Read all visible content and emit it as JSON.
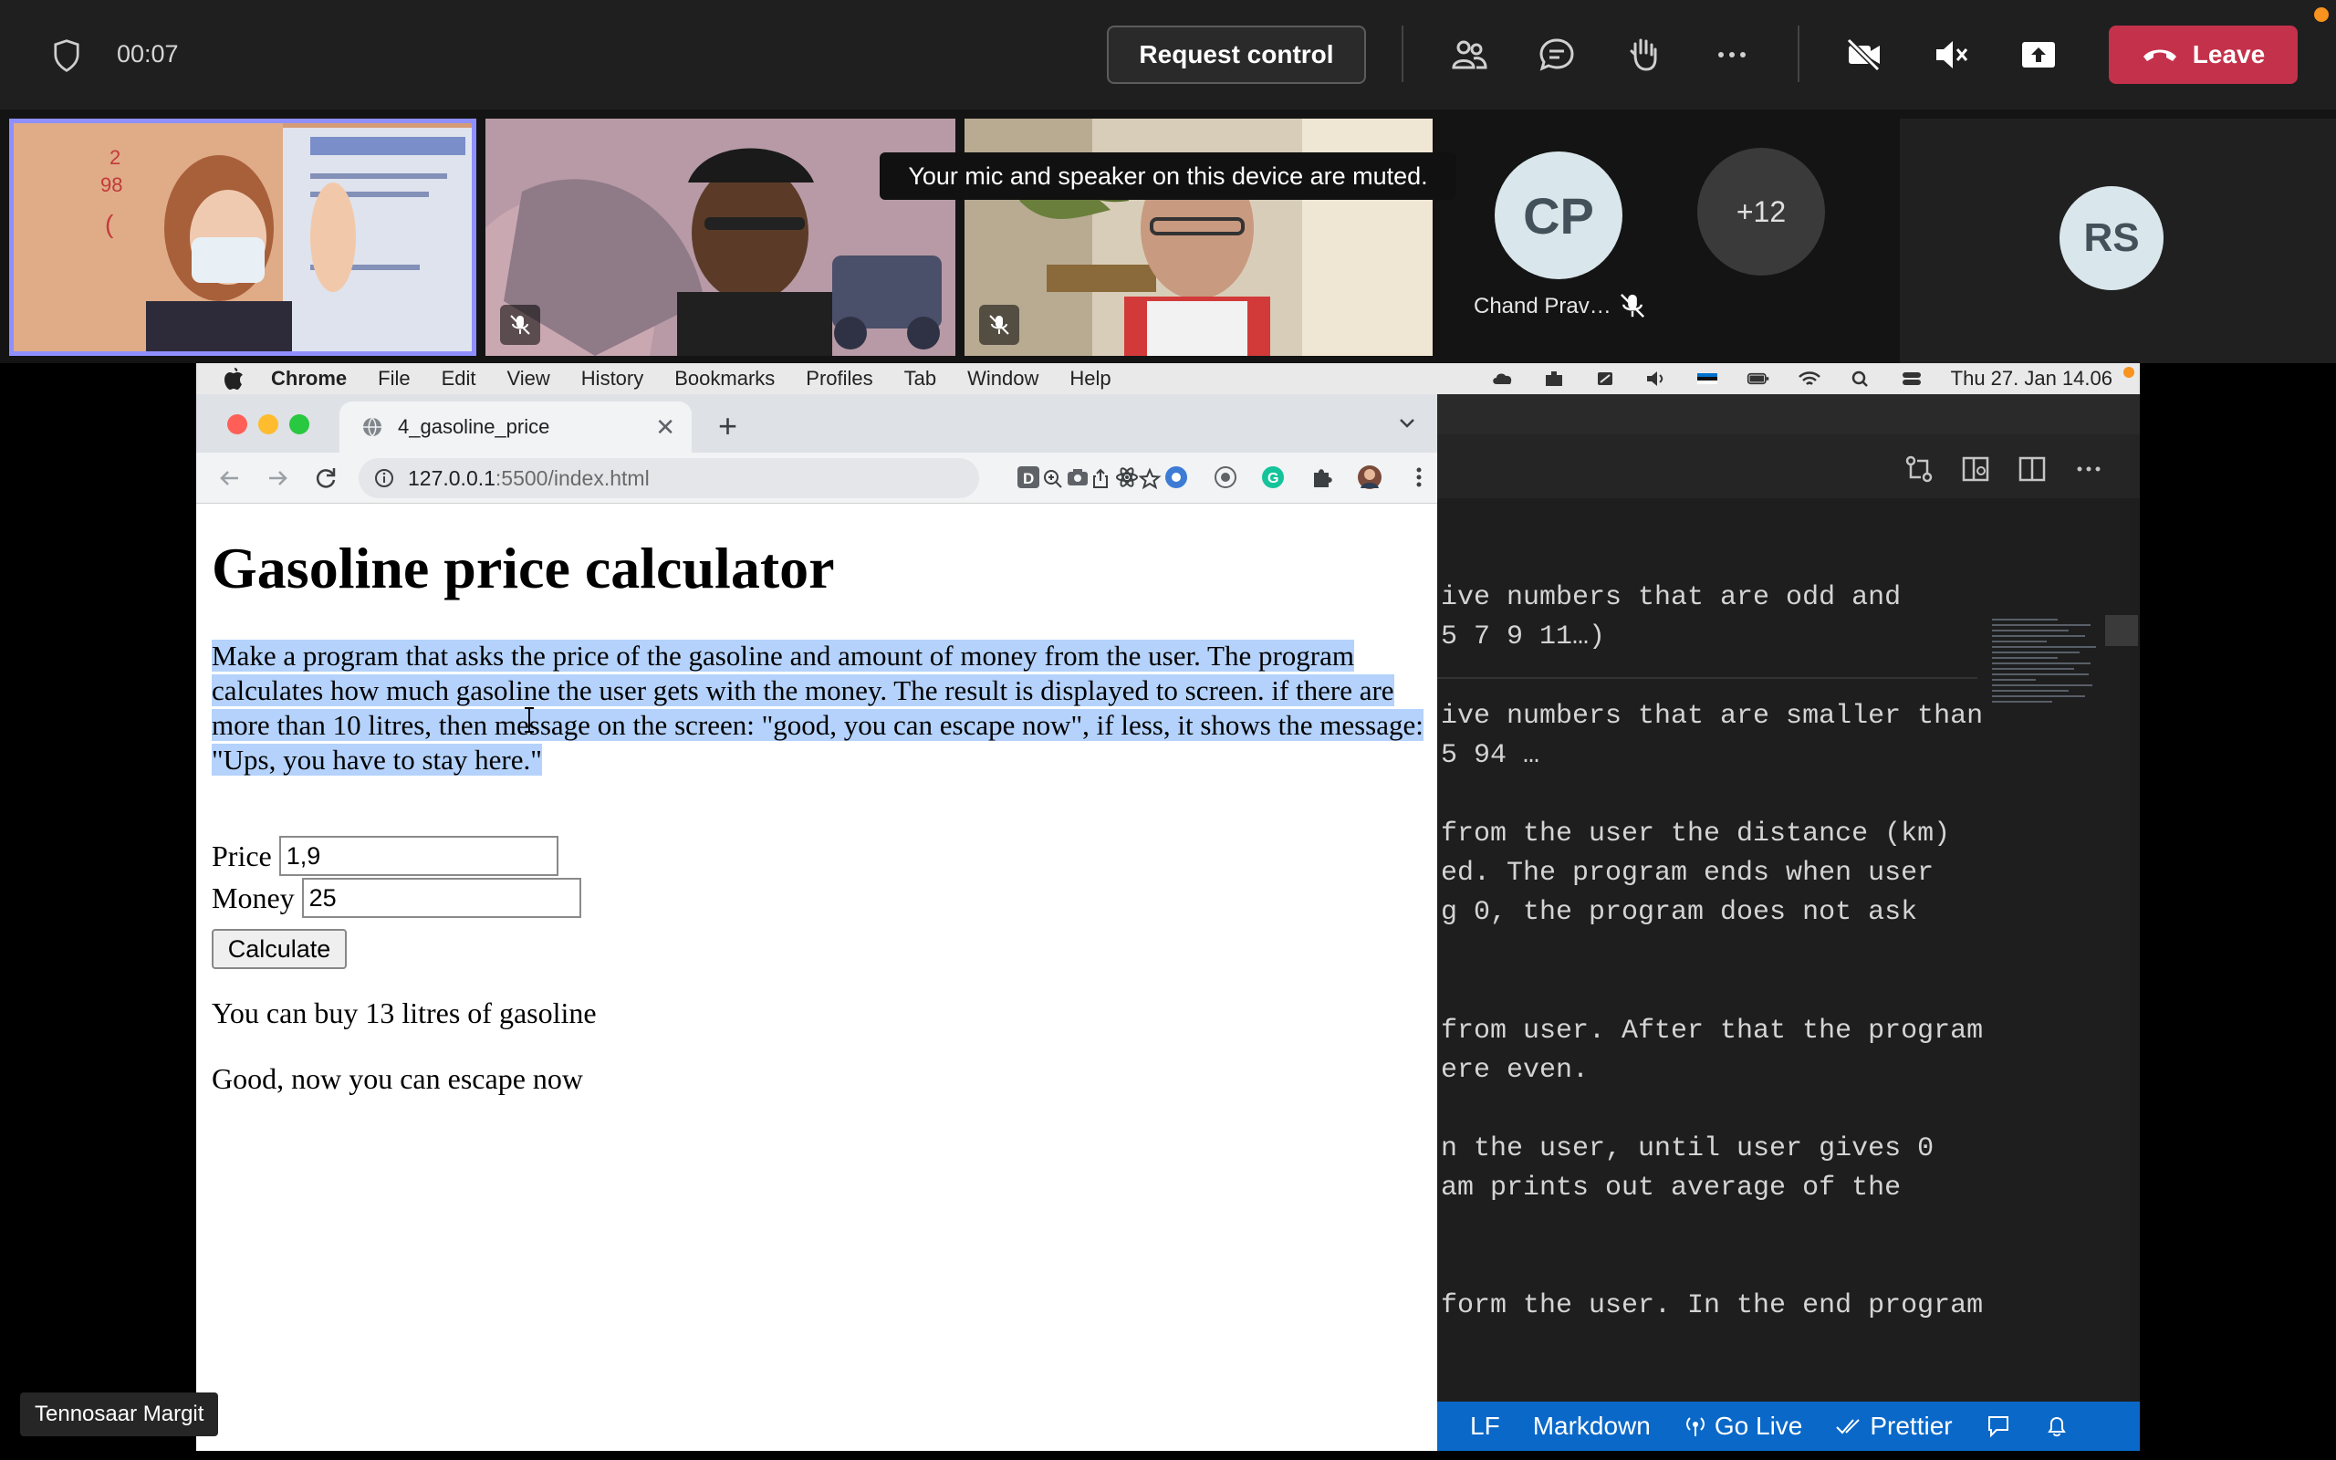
{
  "meeting": {
    "timer": "00:07",
    "request_control_label": "Request control",
    "leave_label": "Leave",
    "toast": "Your mic and speaker on this device are muted.",
    "presenter_name": "Tennosaar Margit"
  },
  "participants": {
    "cp_initials": "CP",
    "cp_name": "Chand Prav…",
    "more_label": "+12",
    "rs_initials": "RS"
  },
  "mac_menubar": {
    "app": "Chrome",
    "items": [
      "File",
      "Edit",
      "View",
      "History",
      "Bookmarks",
      "Profiles",
      "Tab",
      "Window",
      "Help"
    ],
    "clock": "Thu 27. Jan  14.06"
  },
  "chrome": {
    "tab_title": "4_gasoline_price",
    "url_host": "127.0.0.1",
    "url_path": ":5500/index.html"
  },
  "page": {
    "title": "Gasoline price calculator",
    "description": "Make a program that asks the price of the gasoline and amount of money from the user. The program calculates how much gasoline the user gets with the money. The result is displayed to screen. if there are more than 10 litres, then message on the screen: \"good, you can escape now\", if less, it shows the message: \"Ups, you have to stay here.\"",
    "price_label": "Price",
    "price_value": "1,9",
    "money_label": "Money",
    "money_value": "25",
    "calculate_label": "Calculate",
    "result_1": "You can buy 13 litres of gasoline",
    "result_2": "Good, now you can escape now"
  },
  "vscode": {
    "lines": [
      "ive numbers that are odd and",
      "5 7 9 11…)",
      "ive numbers that are smaller than",
      "5 94 …",
      "from the user the distance (km)",
      "ed. The program ends when user",
      "g 0, the program does not ask",
      "from user. After that the program",
      "ere even.",
      "n the user, until user gives 0",
      "am prints out average of the",
      "form the user. In the end program"
    ],
    "status": {
      "eol": "LF",
      "language": "Markdown",
      "go_live": "Go Live",
      "prettier": "Prettier"
    }
  },
  "colors": {
    "leave": "#c4314b",
    "active_tile": "#8f8fff",
    "vscode_status": "#0a68c8",
    "selection": "#b4d2fb"
  }
}
